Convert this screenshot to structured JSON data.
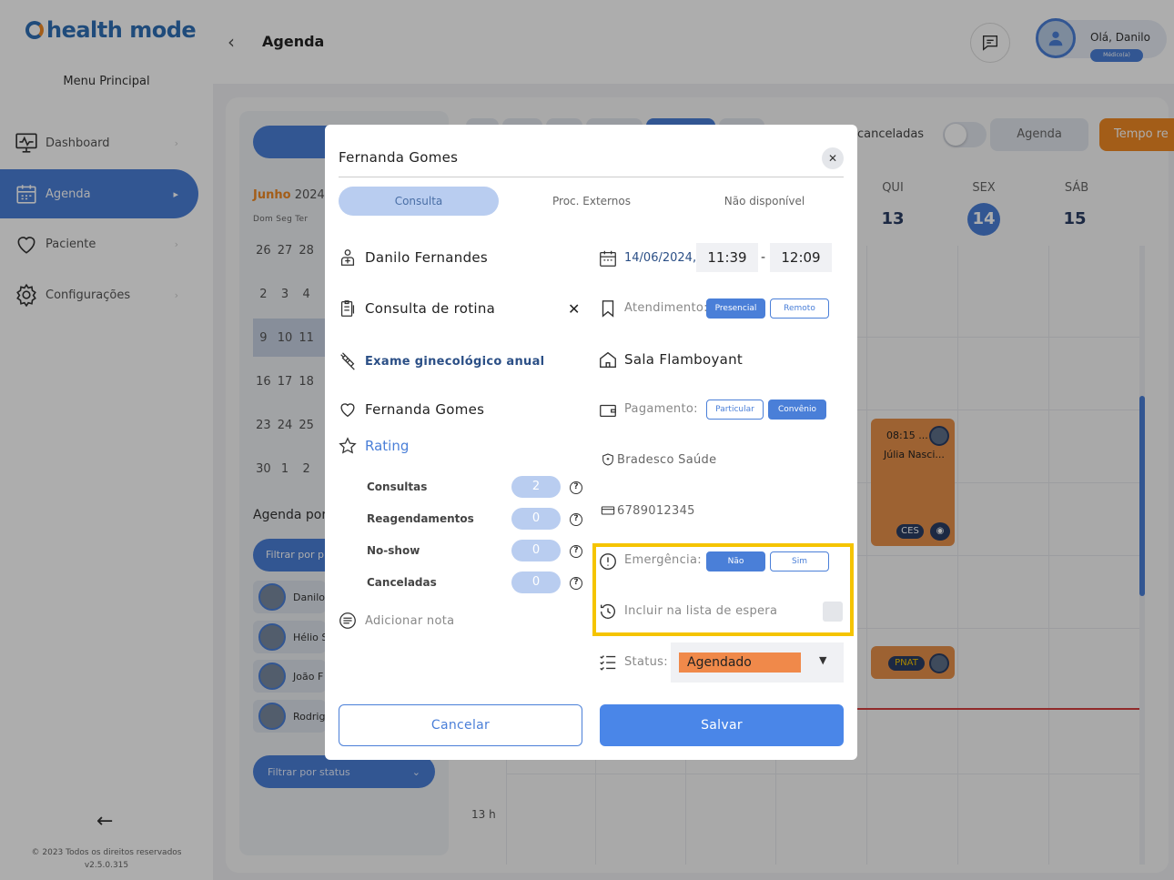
{
  "app": {
    "logo_text": "health mode"
  },
  "sidebar": {
    "menu_title": "Menu Principal",
    "items": [
      {
        "label": "Dashboard",
        "icon": "monitor-icon",
        "active": false
      },
      {
        "label": "Agenda",
        "icon": "calendar-icon",
        "active": true
      },
      {
        "label": "Paciente",
        "icon": "heart-icon",
        "active": false
      },
      {
        "label": "Configurações",
        "icon": "gear-icon",
        "active": false
      }
    ],
    "copyright": "© 2023 Todos os direitos reservados",
    "version": "v2.5.0.315"
  },
  "header": {
    "title": "Agenda",
    "greeting": "Olá, Danilo",
    "role": "Médico(a)"
  },
  "background": {
    "mini_calendar": {
      "month": "Junho",
      "year": "2024",
      "weekdays": "Dom Seg Ter",
      "weeks": [
        [
          "26",
          "27",
          "28"
        ],
        [
          "2",
          "3",
          "4"
        ],
        [
          "9",
          "10",
          "11"
        ],
        [
          "16",
          "17",
          "18"
        ],
        [
          "23",
          "24",
          "25"
        ],
        [
          "30",
          "1",
          "2"
        ]
      ]
    },
    "agenda_por": "Agenda por",
    "filter_placeholder": "Filtrar por pr",
    "doctors": [
      "Danilo",
      "Hélio S",
      "João F",
      "Rodrig"
    ],
    "status_filter": "Filtrar por status",
    "canceladas_label": "canceladas",
    "agenda_button": "Agenda",
    "tempo_button": "Tempo re",
    "days": [
      {
        "label": "QUI",
        "num": "13",
        "today": false
      },
      {
        "label": "SEX",
        "num": "14",
        "today": true
      },
      {
        "label": "SÁB",
        "num": "15",
        "today": false
      }
    ],
    "appointment": {
      "time": "08:15 ...",
      "name": "Júlia Nasci...",
      "badge": "CES"
    },
    "appointment2": {
      "badge": "PNAT"
    },
    "hour_label": "13 h"
  },
  "modal": {
    "title": "Fernanda Gomes",
    "tabs": [
      {
        "label": "Consulta",
        "active": true
      },
      {
        "label": "Proc. Externos",
        "active": false
      },
      {
        "label": "Não disponível",
        "active": false
      }
    ],
    "professional": "Danilo Fernandes",
    "appointment_type": "Consulta de rotina",
    "procedure": "Exame ginecológico anual",
    "patient": "Fernanda Gomes",
    "rating_label": "Rating",
    "stats": [
      {
        "label": "Consultas",
        "value": "2"
      },
      {
        "label": "Reagendamentos",
        "value": "0"
      },
      {
        "label": "No-show",
        "value": "0"
      },
      {
        "label": "Canceladas",
        "value": "0"
      }
    ],
    "add_note": "Adicionar nota",
    "date": "14/06/2024",
    "date_sep": ",",
    "start_time": "11:39",
    "time_sep": "-",
    "end_time": "12:09",
    "attendance_label": "Atendimento:",
    "attendance_options": [
      "Presencial",
      "Remoto"
    ],
    "room": "Sala Flamboyant",
    "payment_label": "Pagamento:",
    "payment_options": [
      "Particular",
      "Convênio"
    ],
    "insurance": "Bradesco Saúde",
    "card_number": "6789012345",
    "emergency_label": "Emergência:",
    "emergency_options": [
      "Não",
      "Sim"
    ],
    "waitlist_label": "Incluir na lista de espera",
    "status_label": "Status:",
    "status_value": "Agendado",
    "cancel_button": "Cancelar",
    "save_button": "Salvar",
    "colors": {
      "accent": "#4a86e8",
      "status": "#f0894a",
      "highlight": "#f5c400"
    }
  }
}
